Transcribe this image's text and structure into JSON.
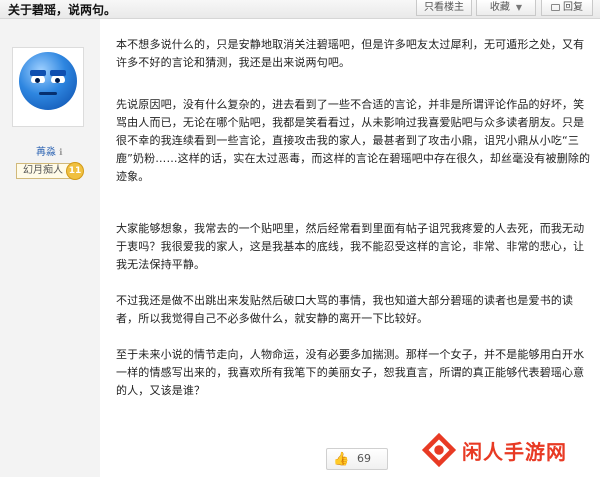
{
  "header": {
    "title": "关于碧瑶，说两句。",
    "only_lz_label": "只看楼主",
    "favorite_label": "收藏",
    "reply_label": "回复"
  },
  "author": {
    "username": "苒淼",
    "rank_title": "幻月痴人",
    "level": "11"
  },
  "post": {
    "paragraphs": [
      "本不想多说什么的，只是安静地取消关注碧瑶吧，但是许多吧友太过犀利，无可遁形之处，又有许多不好的言论和猜测，我还是出来说两句吧。",
      "先说原因吧，没有什么复杂的，进去看到了一些不合适的言论，并非是所谓评论作品的好坏，笑骂由人而已，无论在哪个贴吧，我都是笑看看过，从未影响过我喜爱贴吧与众多读者朋友。只是很不幸的我连续看到一些言论，直接攻击我的家人，最甚者到了攻击小鼎，诅咒小鼎从小吃“三鹿”奶粉……这样的话，实在太过恶毒，而这样的言论在碧瑶吧中存在很久，却丝毫没有被删除的迹象。",
      "大家能够想象，我常去的一个贴吧里，然后经常看到里面有帖子诅咒我疼爱的人去死，而我无动于衷吗？我很爱我的家人，这是我基本的底线，我不能忍受这样的言论，非常、非常的悲心，让我无法保持平静。",
      "不过我还是做不出跳出来发贴然后破口大骂的事情，我也知道大部分碧瑶的读者也是爱书的读者，所以我觉得自己不必多做什么，就安静的离开一下比较好。",
      "至于未来小说的情节走向，人物命运，没有必要多加揣测。那样一个女子，并不是能够用白开水一样的情感写出来的，我喜欢所有我笔下的美丽女子，恕我直言，所谓的真正能够代表碧瑶心意的人，又该是谁？"
    ]
  },
  "like": {
    "count": "69",
    "icon": "thumbs-up-icon"
  },
  "watermark": {
    "text": "闲人手游网"
  },
  "colors": {
    "accent": "#2d64b3",
    "watermark": "#e83a24"
  }
}
